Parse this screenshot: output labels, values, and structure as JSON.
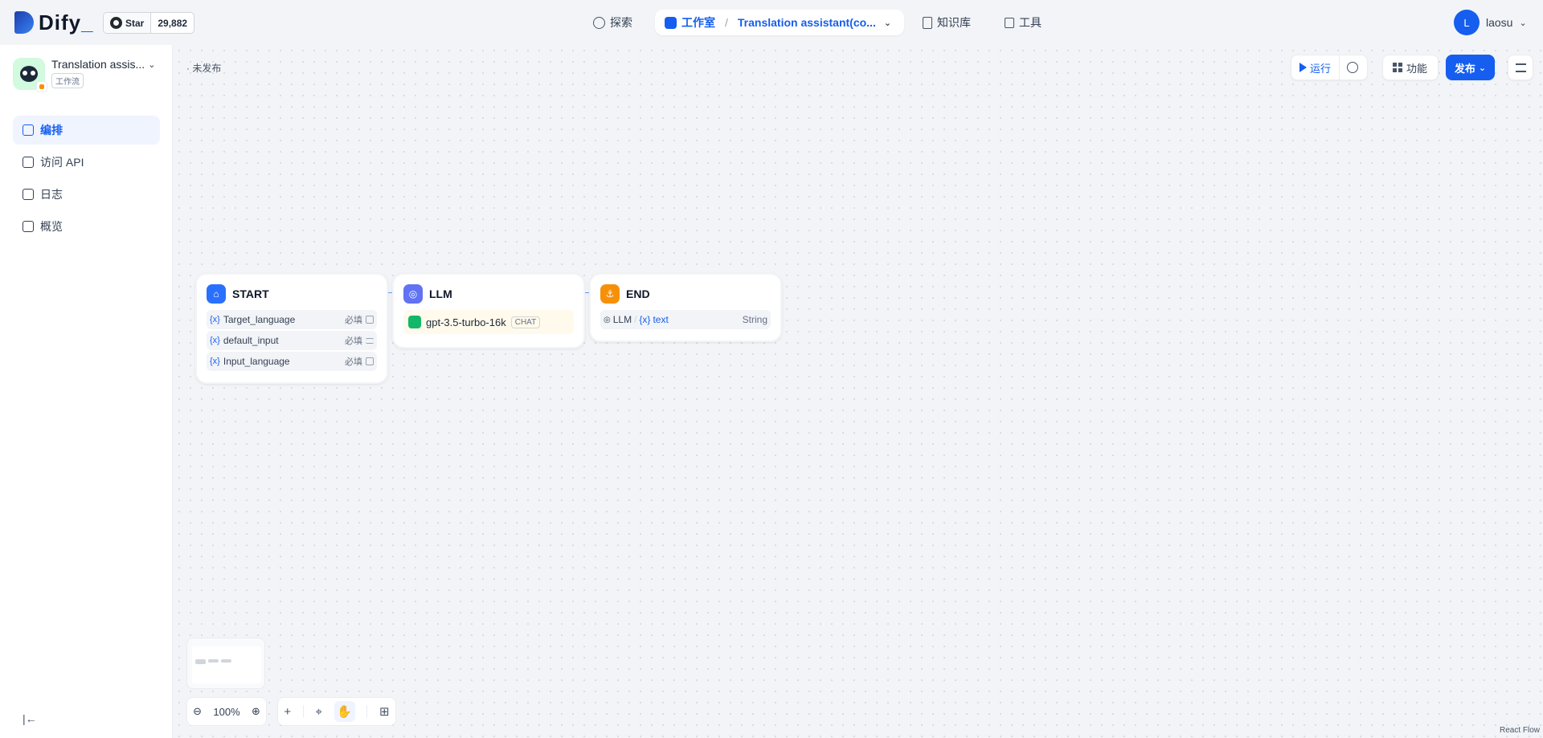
{
  "header": {
    "logo_text": "Dify",
    "logo_underscore": "_",
    "github_star_label": "Star",
    "github_star_count": "29,882",
    "nav": {
      "explore": "探索",
      "studio": "工作室",
      "app_name": "Translation assistant(co...",
      "knowledge": "知识库",
      "tools": "工具"
    },
    "user": {
      "initial": "L",
      "name": "laosu"
    }
  },
  "sidebar": {
    "app_title": "Translation assis...",
    "app_type": "工作流",
    "items": [
      {
        "label": "编排",
        "active": true
      },
      {
        "label": "访问 API"
      },
      {
        "label": "日志"
      },
      {
        "label": "概览"
      }
    ]
  },
  "canvas": {
    "status": "· 未发布",
    "toolbar": {
      "run": "运行",
      "features": "功能",
      "publish": "发布"
    },
    "nodes": {
      "start": {
        "title": "START",
        "vars": [
          {
            "x": "{x}",
            "name": "Target_language",
            "required": "必填"
          },
          {
            "x": "{x}",
            "name": "default_input",
            "required": "必填"
          },
          {
            "x": "{x}",
            "name": "Input_language",
            "required": "必填"
          }
        ]
      },
      "llm": {
        "title": "LLM",
        "model": "gpt-3.5-turbo-16k",
        "mode": "CHAT"
      },
      "end": {
        "title": "END",
        "source_node": "LLM",
        "var_x": "{x}",
        "var_name": "text",
        "var_type": "String"
      }
    },
    "zoom": "100%",
    "attribution": "React Flow"
  },
  "colors": {
    "accent": "#155eef",
    "start_icon": "#2970ff",
    "llm_icon": "#6172f3",
    "end_icon": "#f79009"
  }
}
